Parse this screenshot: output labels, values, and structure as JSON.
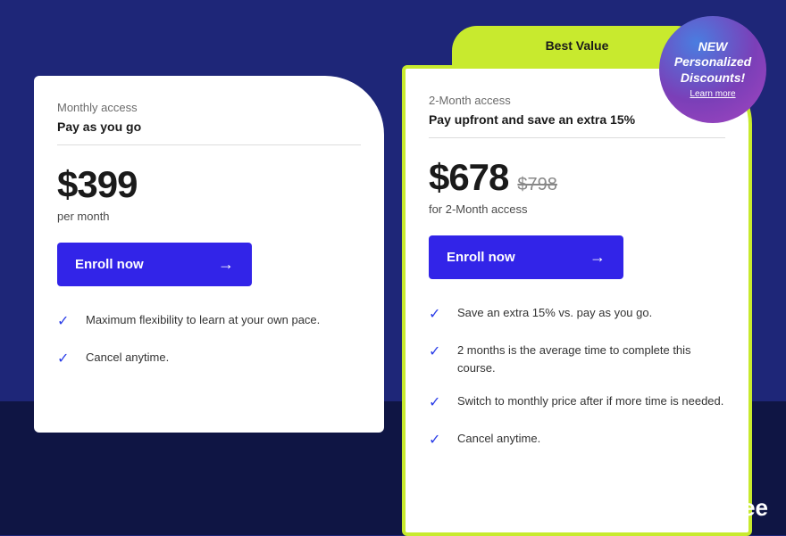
{
  "promo": {
    "line1": "NEW",
    "line2": "Personalized",
    "line3": "Discounts!",
    "learn_more": "Learn more"
  },
  "plans": {
    "monthly": {
      "label": "Monthly access",
      "subtitle": "Pay as you go",
      "price": "$399",
      "price_sub": "per month",
      "enroll_label": "Enroll now",
      "features": [
        "Maximum flexibility to learn at your own pace.",
        "Cancel anytime."
      ]
    },
    "upfront": {
      "badge": "Best Value",
      "label": "2-Month access",
      "subtitle": "Pay upfront and save an extra 15%",
      "price": "$678",
      "price_strike": "$798",
      "price_sub": "for 2-Month access",
      "enroll_label": "Enroll now",
      "features": [
        "Save an extra 15% vs. pay as you go.",
        "2 months is the average time to complete this course.",
        "Switch to monthly price after if more time is needed.",
        "Cancel anytime."
      ]
    }
  },
  "brand": {
    "name": "BitDegree"
  },
  "colors": {
    "accent": "#3224e8",
    "highlight": "#c8ea2e",
    "page_bg": "#1e2678",
    "page_bg_dark": "#0f1544"
  }
}
